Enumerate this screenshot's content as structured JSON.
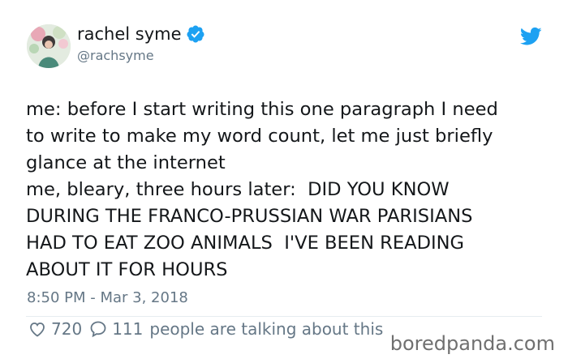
{
  "author": {
    "display_name": "rachel syme",
    "handle": "@rachsyme",
    "verified": true
  },
  "tweet": {
    "lines": [
      "me: before I start writing this one paragraph I need",
      "to write to make my word count, let me just briefly",
      "glance at the internet",
      "me, bleary, three hours later:  DID YOU KNOW",
      "DURING THE FRANCO-PRUSSIAN WAR PARISIANS",
      "HAD TO EAT ZOO ANIMALS  I'VE BEEN READING",
      "ABOUT IT FOR HOURS"
    ],
    "timestamp": "8:50 PM - Mar 3, 2018"
  },
  "actions": {
    "likes": "720",
    "replies": "111",
    "talking": "people are talking about this"
  },
  "watermark": "boredpanda.com",
  "colors": {
    "twitter_blue": "#1da1f2",
    "text": "#14171a",
    "muted": "#657786"
  }
}
